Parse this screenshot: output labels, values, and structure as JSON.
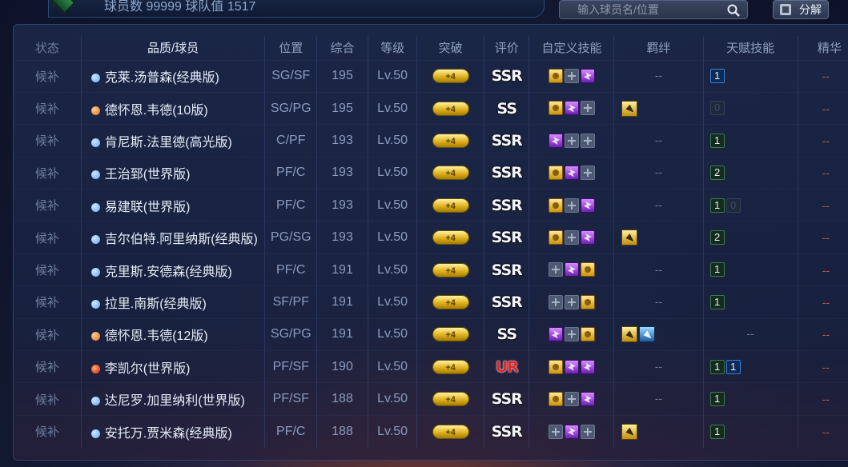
{
  "header": {
    "stat_text": "球员数 99999 球队值 1517",
    "search_placeholder": "输入球员名/位置",
    "decompose_label": "分解"
  },
  "columns": {
    "status": "状态",
    "name": "品质/球员",
    "position": "位置",
    "overall": "综合",
    "level": "等级",
    "breakthrough": "突破",
    "rating": "评价",
    "custom_skills": "自定义技能",
    "bond": "羁绊",
    "talent": "天赋技能",
    "essence": "精华"
  },
  "rows": [
    {
      "status": "候补",
      "quality": "blue",
      "name": "克莱.汤普森(经典版)",
      "position": "SG/SF",
      "overall": "195",
      "level": "Lv.50",
      "breakthrough": "+4",
      "rating": "SSR",
      "skills": [
        "gold",
        "empty",
        "purple"
      ],
      "bond": [],
      "bond_text": "--",
      "talent": [
        {
          "v": "1",
          "t": "b"
        }
      ],
      "talent_text": "",
      "essence": "--"
    },
    {
      "status": "候补",
      "quality": "orange",
      "name": "德怀恩.韦德(10版)",
      "position": "SG/PG",
      "overall": "195",
      "level": "Lv.50",
      "breakthrough": "+4",
      "rating": "SS",
      "skills": [
        "gold",
        "purple",
        "empty"
      ],
      "bond": [
        "gold"
      ],
      "bond_text": "",
      "talent": [
        {
          "v": "0",
          "t": "d"
        }
      ],
      "talent_text": "",
      "essence": "--"
    },
    {
      "status": "候补",
      "quality": "blue",
      "name": "肯尼斯.法里德(高光版)",
      "position": "C/PF",
      "overall": "193",
      "level": "Lv.50",
      "breakthrough": "+4",
      "rating": "SSR",
      "skills": [
        "purple",
        "empty",
        "empty"
      ],
      "bond": [],
      "bond_text": "--",
      "talent": [
        {
          "v": "1",
          "t": "g"
        }
      ],
      "talent_text": "",
      "essence": "--"
    },
    {
      "status": "候补",
      "quality": "blue",
      "name": "王治郅(世界版)",
      "position": "PF/C",
      "overall": "193",
      "level": "Lv.50",
      "breakthrough": "+4",
      "rating": "SSR",
      "skills": [
        "gold",
        "purple",
        "empty"
      ],
      "bond": [],
      "bond_text": "--",
      "talent": [
        {
          "v": "2",
          "t": "g"
        }
      ],
      "talent_text": "",
      "essence": "--"
    },
    {
      "status": "候补",
      "quality": "blue",
      "name": "易建联(世界版)",
      "position": "PF/C",
      "overall": "193",
      "level": "Lv.50",
      "breakthrough": "+4",
      "rating": "SSR",
      "skills": [
        "gold",
        "empty",
        "purple"
      ],
      "bond": [],
      "bond_text": "--",
      "talent": [
        {
          "v": "1",
          "t": "g"
        },
        {
          "v": "0",
          "t": "d"
        }
      ],
      "talent_text": "",
      "essence": "--"
    },
    {
      "status": "候补",
      "quality": "blue",
      "name": "吉尔伯特.阿里纳斯(经典版)",
      "position": "PG/SG",
      "overall": "193",
      "level": "Lv.50",
      "breakthrough": "+4",
      "rating": "SSR",
      "skills": [
        "gold",
        "empty",
        "purple"
      ],
      "bond": [
        "gold"
      ],
      "bond_text": "",
      "talent": [
        {
          "v": "2",
          "t": "g"
        }
      ],
      "talent_text": "",
      "essence": "--"
    },
    {
      "status": "候补",
      "quality": "blue",
      "name": "克里斯.安德森(经典版)",
      "position": "PF/C",
      "overall": "191",
      "level": "Lv.50",
      "breakthrough": "+4",
      "rating": "SSR",
      "skills": [
        "empty",
        "purple",
        "gold"
      ],
      "bond": [],
      "bond_text": "--",
      "talent": [
        {
          "v": "1",
          "t": "g"
        }
      ],
      "talent_text": "",
      "essence": "--"
    },
    {
      "status": "候补",
      "quality": "blue",
      "name": "拉里.南斯(经典版)",
      "position": "SF/PF",
      "overall": "191",
      "level": "Lv.50",
      "breakthrough": "+4",
      "rating": "SSR",
      "skills": [
        "empty",
        "empty",
        "gold"
      ],
      "bond": [],
      "bond_text": "--",
      "talent": [
        {
          "v": "1",
          "t": "g"
        }
      ],
      "talent_text": "",
      "essence": "--"
    },
    {
      "status": "候补",
      "quality": "orange",
      "name": "德怀恩.韦德(12版)",
      "position": "SG/PG",
      "overall": "191",
      "level": "Lv.50",
      "breakthrough": "+4",
      "rating": "SS",
      "skills": [
        "purple",
        "empty",
        "gold"
      ],
      "bond": [
        "gold",
        "blue"
      ],
      "bond_text": "",
      "talent": [],
      "talent_text": "--",
      "essence": "--"
    },
    {
      "status": "候补",
      "quality": "red",
      "name": "李凯尔(世界版)",
      "position": "PF/SF",
      "overall": "190",
      "level": "Lv.50",
      "breakthrough": "+4",
      "rating": "UR",
      "skills": [
        "gold",
        "purple",
        "purple"
      ],
      "bond": [],
      "bond_text": "--",
      "talent": [
        {
          "v": "1",
          "t": "g"
        },
        {
          "v": "1",
          "t": "b"
        }
      ],
      "talent_text": "",
      "essence": "--"
    },
    {
      "status": "候补",
      "quality": "blue",
      "name": "达尼罗.加里纳利(世界版)",
      "position": "PF/SF",
      "overall": "188",
      "level": "Lv.50",
      "breakthrough": "+4",
      "rating": "SSR",
      "skills": [
        "gold",
        "empty",
        "purple"
      ],
      "bond": [],
      "bond_text": "--",
      "talent": [
        {
          "v": "1",
          "t": "g"
        }
      ],
      "talent_text": "",
      "essence": "--"
    },
    {
      "status": "候补",
      "quality": "blue",
      "name": "安托万.贾米森(经典版)",
      "position": "PF/C",
      "overall": "188",
      "level": "Lv.50",
      "breakthrough": "+4",
      "rating": "SSR",
      "skills": [
        "empty",
        "purple",
        "empty"
      ],
      "bond": [
        "gold"
      ],
      "bond_text": "",
      "talent": [
        {
          "v": "1",
          "t": "g"
        }
      ],
      "talent_text": "",
      "essence": "--"
    }
  ]
}
